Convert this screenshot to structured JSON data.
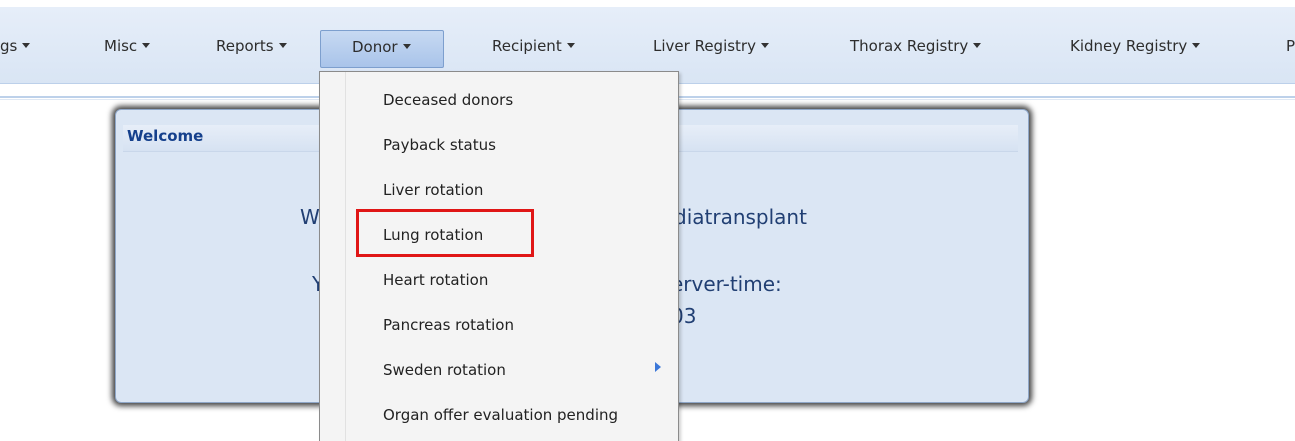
{
  "menubar": {
    "items": [
      {
        "label": "gs"
      },
      {
        "label": "Misc"
      },
      {
        "label": "Reports"
      },
      {
        "label": "Donor",
        "active": true
      },
      {
        "label": "Recipient"
      },
      {
        "label": "Liver Registry"
      },
      {
        "label": "Thorax Registry"
      },
      {
        "label": "Kidney Registry"
      },
      {
        "label": "P"
      }
    ]
  },
  "welcome": {
    "title": "Welcome",
    "line1_left": "W",
    "line1_right": "diatransplant",
    "line2_left": "Y",
    "line2_right": "erver-time:",
    "line3_right": "03"
  },
  "donor_menu": {
    "items": [
      {
        "label": "Deceased donors"
      },
      {
        "label": "Payback status"
      },
      {
        "label": "Liver rotation"
      },
      {
        "label": "Lung rotation",
        "highlighted": true
      },
      {
        "label": "Heart rotation"
      },
      {
        "label": "Pancreas rotation"
      },
      {
        "label": "Sweden rotation",
        "has_submenu": true,
        "submenu_icon": "triangle-right-icon"
      },
      {
        "label": "Organ offer evaluation pending"
      }
    ]
  },
  "colors": {
    "menubar_background": "#dbe6f4",
    "active_menu": "#b7cdee",
    "highlight_border": "#e01616",
    "welcome_text": "#213f73"
  }
}
